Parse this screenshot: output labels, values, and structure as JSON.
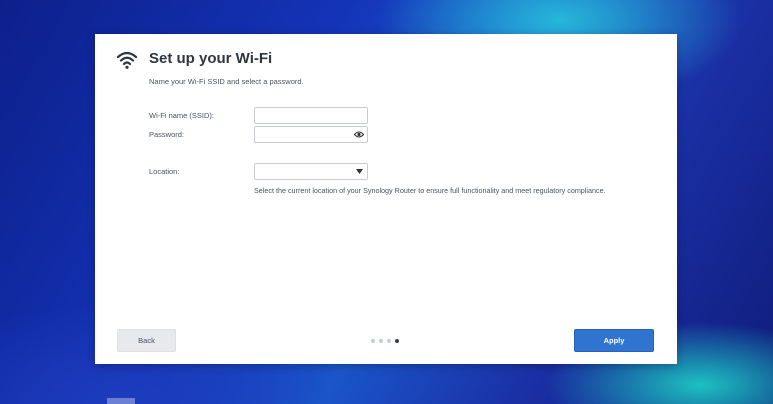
{
  "dialog": {
    "title": "Set up your Wi-Fi",
    "subtitle": "Name your Wi-Fi SSID and select a password.",
    "icon": "wifi-icon"
  },
  "form": {
    "ssid_label": "Wi-Fi name (SSID):",
    "ssid_value": "",
    "password_label": "Password:",
    "password_value": "",
    "password_toggle_icon": "eye-icon",
    "location_label": "Location:",
    "location_value": "",
    "location_hint": "Select the current location of your Synology Router to ensure full functionality and meet regulatory compliance."
  },
  "footer": {
    "back_label": "Back",
    "apply_label": "Apply",
    "steps_total": 4,
    "steps_current": 4
  },
  "colors": {
    "accent": "#2f74cf",
    "title_text": "#2f3640",
    "body_text": "#4a5360",
    "active_step": "#34414f"
  }
}
